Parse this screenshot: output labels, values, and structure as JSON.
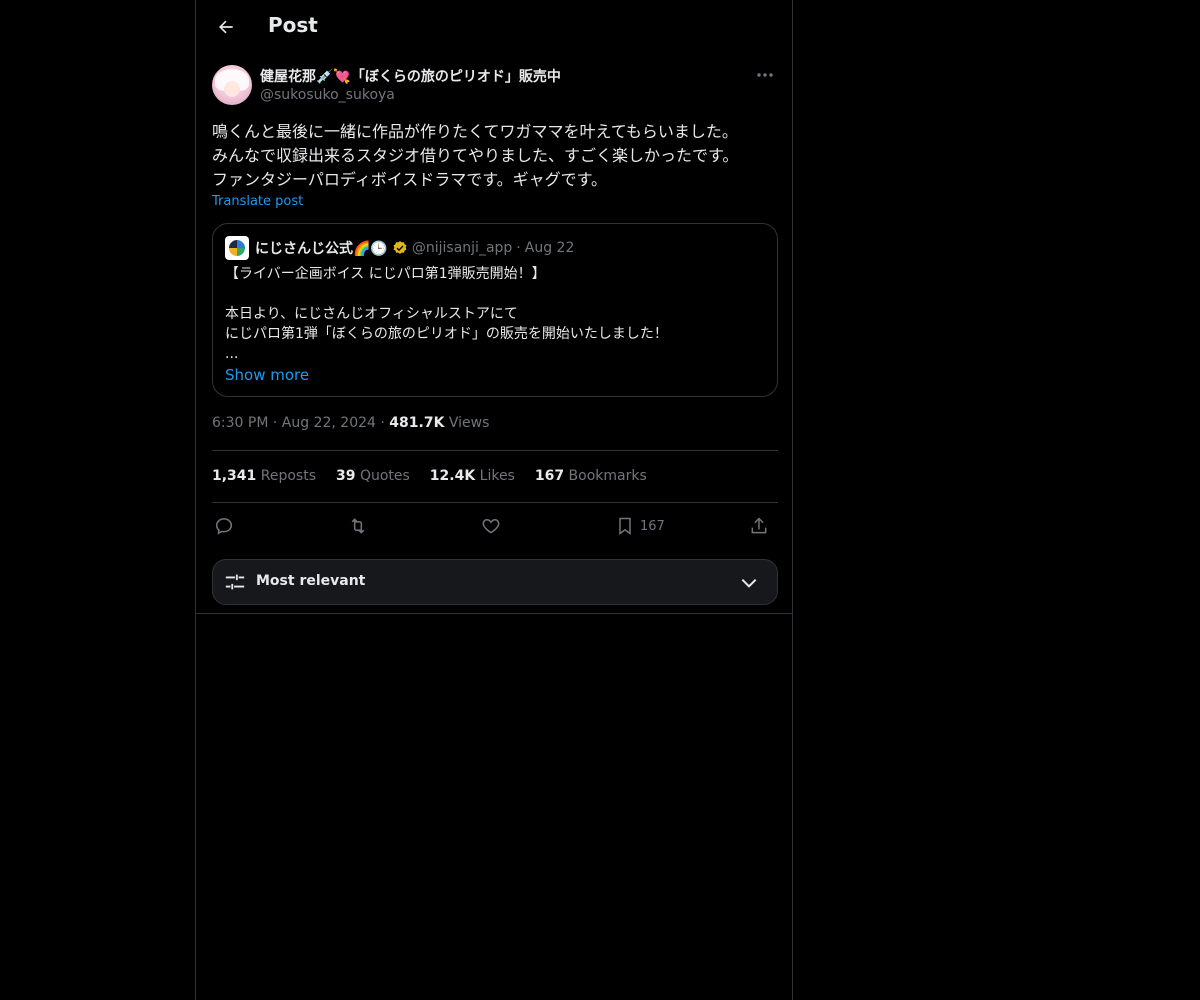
{
  "header": {
    "title": "Post"
  },
  "post": {
    "author_name": "健屋花那💉💘「ぼくらの旅のピリオド」販売中",
    "author_handle": "@sukosuko_sukoya",
    "text": "鳴くんと最後に一緒に作品が作りたくてワガママを叶えてもらいました。\nみんなで収録出来るスタジオ借りてやりました、すごく楽しかったです。\nファンタジーパロディボイスドラマです。ギャグです。",
    "translate_label": "Translate post",
    "time": "6:30 PM",
    "date": "Aug 22, 2024",
    "views_count": "481.7K",
    "views_label": "Views"
  },
  "quote": {
    "name": "にじさんじ公式🌈🕒",
    "handle": "@nijisanji_app",
    "date": "Aug 22",
    "body": "【ライバー企画ボイス にじパロ第1弾販売開始！】\n\n本日より、にじさんじオフィシャルストアにて\nにじパロ第1弾「ぼくらの旅のピリオド」の販売を開始いたしました！\n...",
    "show_more": "Show more"
  },
  "stats": {
    "reposts_count": "1,341",
    "reposts_label": "Reposts",
    "quotes_count": "39",
    "quotes_label": "Quotes",
    "likes_count": "12.4K",
    "likes_label": "Likes",
    "bookmarks_count": "167",
    "bookmarks_label": "Bookmarks"
  },
  "actions": {
    "bookmark_count": "167"
  },
  "sort": {
    "label": "Most relevant"
  },
  "colors": {
    "accent": "#1d9bf0",
    "verified": "#e2b719",
    "background": "#000000",
    "border": "#2f3336"
  }
}
